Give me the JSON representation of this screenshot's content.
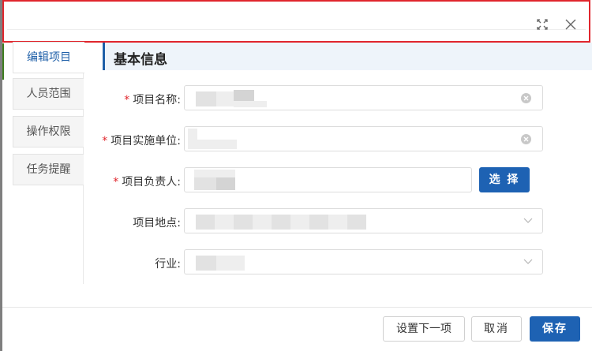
{
  "nav": {
    "tabs": [
      {
        "label": "编辑项目"
      },
      {
        "label": "人员范围"
      },
      {
        "label": "操作权限"
      },
      {
        "label": "任务提醒"
      }
    ]
  },
  "section": {
    "title": "基本信息"
  },
  "form": {
    "project_name": {
      "label": "项目名称:",
      "required": true
    },
    "implementing_unit": {
      "label": "项目实施单位:",
      "required": true
    },
    "project_lead": {
      "label": "项目负责人:",
      "required": true,
      "select_label": "选 择"
    },
    "location": {
      "label": "项目地点:",
      "required": false
    },
    "industry": {
      "label": "行业:",
      "required": false
    }
  },
  "footer": {
    "next_label": "设置下一项",
    "cancel_label": "取消",
    "save_label": "保存"
  },
  "icons": {
    "maximize": "maximize-icon",
    "close": "close-icon",
    "clear": "clear-icon",
    "dropdown": "chevron-down-icon"
  },
  "colors": {
    "accent": "#1e62b3",
    "highlight_border": "#e0262d",
    "required_star": "#e0262d"
  }
}
